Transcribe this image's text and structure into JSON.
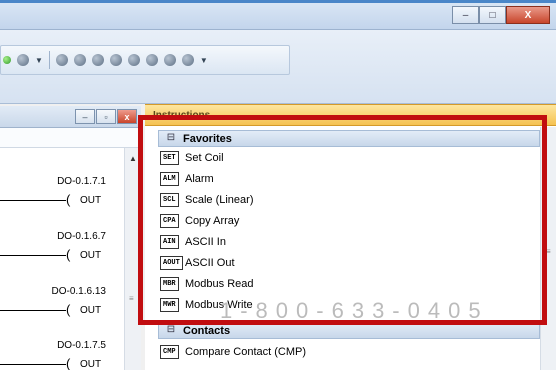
{
  "window": {
    "minimize_glyph": "–",
    "maximize_glyph": "□",
    "close_glyph": "X"
  },
  "ladder": {
    "minimize_glyph": "–",
    "restore_glyph": "▫",
    "close_glyph": "x",
    "rungs": [
      {
        "address": "DO-0.1.7.1",
        "coil": "(",
        "op": "OUT"
      },
      {
        "address": "DO-0.1.6.7",
        "coil": "(",
        "op": "OUT"
      },
      {
        "address": "DO-0.1.6.13",
        "coil": "(",
        "op": "OUT"
      },
      {
        "address": "DO-0.1.7.5",
        "coil": "(",
        "op": "OUT"
      }
    ]
  },
  "instructions": {
    "title": "Instructions",
    "favorites_label": "Favorites",
    "favorites": [
      {
        "tag": "SET",
        "label": "Set Coil"
      },
      {
        "tag": "ALM",
        "label": "Alarm"
      },
      {
        "tag": "SCL",
        "label": "Scale (Linear)"
      },
      {
        "tag": "CPA",
        "label": "Copy Array"
      },
      {
        "tag": "AIN",
        "label": "ASCII In"
      },
      {
        "tag": "AOUT",
        "label": "ASCII Out"
      },
      {
        "tag": "MBR",
        "label": "Modbus Read"
      },
      {
        "tag": "MWR",
        "label": "Modbus Write"
      }
    ],
    "contacts_label": "Contacts",
    "contacts": [
      {
        "tag": "CMP",
        "label": "Compare Contact  (CMP)"
      }
    ]
  },
  "watermark": "1-800-633-0405",
  "colors": {
    "highlight": "#c10d10",
    "instr_header": "#f5c251",
    "titlebar": "#c3d5ec"
  }
}
